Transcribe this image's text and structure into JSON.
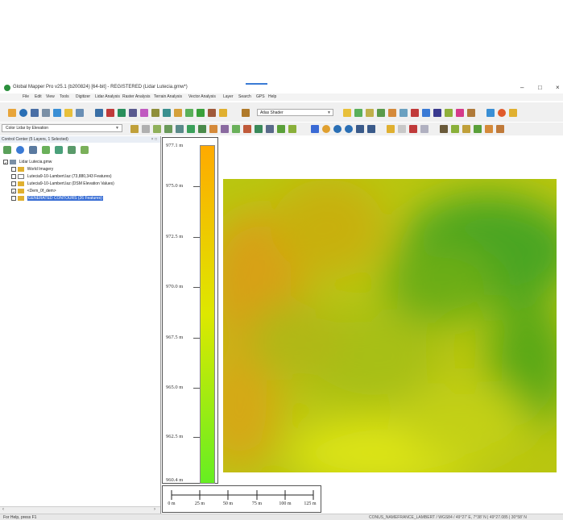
{
  "window": {
    "title": "Global Mapper Pro v25.1 (b200824) [64-bit] - REGISTERED (Lidar Lutecia.gmw*)",
    "minimize": "–",
    "maximize": "□",
    "close": "×"
  },
  "menu": [
    "File",
    "Edit",
    "View",
    "Tools",
    "Digitizer",
    "Lidar Analysis",
    "Raster Analysis",
    "Terrain Analysis",
    "Vector Analysis",
    "Layer",
    "Search",
    "GPS",
    "Help"
  ],
  "toolbar": {
    "shader_select": "Atlas Shader",
    "color_select": "Color Lidar by Elevation"
  },
  "control_center": {
    "title": "Control Center (5 Layers, 1 Selected)",
    "close": "× □",
    "layers": [
      {
        "label": "Lidar Lutecia.gmw",
        "checked": true
      },
      {
        "label": "World Imagery",
        "checked": false
      },
      {
        "label": "Lutecia9-10-Lambert.laz (73,880,343 Features)",
        "checked": false
      },
      {
        "label": "Lutecia9-10-Lambert.laz (DSM Elevation Values)",
        "checked": false
      },
      {
        "label": "<Dem_0f_dem>",
        "checked": true
      },
      {
        "label": "GENERATED CONTOURS (26 Features)",
        "checked": false,
        "selected": true
      }
    ]
  },
  "legend": {
    "labels": [
      "977.1 m",
      "975.0 m",
      "972.5 m",
      "970.0 m",
      "967.5 m",
      "965.0 m",
      "962.5 m",
      "960.4 m"
    ],
    "color_top": "#ffaa00",
    "color_mid": "#dde800",
    "color_bottom": "#66ee22"
  },
  "scalebar": {
    "labels": [
      "0 m",
      "25 m",
      "50 m",
      "75 m",
      "100 m",
      "125 m"
    ]
  },
  "status": {
    "help": "For Help, press F1",
    "coords": "CONUS_NAMEFRANCE_LAMBERT / WGS84 / 49°27' E, 7°38' N | 49°27.085 | 30°58' N"
  }
}
